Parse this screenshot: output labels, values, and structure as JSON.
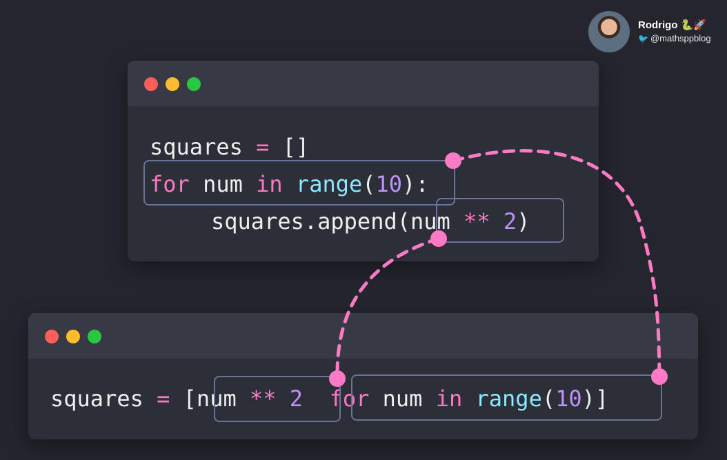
{
  "author": {
    "name": "Rodrigo 🐍🚀",
    "handle": "@mathsppblog"
  },
  "top_window": {
    "line1": {
      "var": "squares",
      "op": "=",
      "brackets": "[]"
    },
    "line2": {
      "for": "for",
      "var": "num",
      "in": "in",
      "func": "range",
      "open": "(",
      "arg": "10",
      "close": ")",
      "colon": ":"
    },
    "line3": {
      "obj": "squares",
      "method": ".append",
      "open": "(",
      "var": "num",
      "op": "**",
      "arg": "2",
      "close": ")"
    }
  },
  "bottom_window": {
    "var": "squares",
    "op": "=",
    "open_bracket": "[",
    "expr_var": "num",
    "expr_op": "**",
    "expr_arg": "2",
    "for": "for",
    "loop_var": "num",
    "in": "in",
    "func": "range",
    "open": "(",
    "arg": "10",
    "close": ")",
    "close_bracket": "]"
  },
  "colors": {
    "background": "#24252d",
    "window": "#2c2e38",
    "titlebar": "#373945",
    "keyword": "#ff79c6",
    "function": "#8be9fd",
    "number": "#bd93f9",
    "connector": "#ff7ac6",
    "box_border": "#6b7396"
  }
}
